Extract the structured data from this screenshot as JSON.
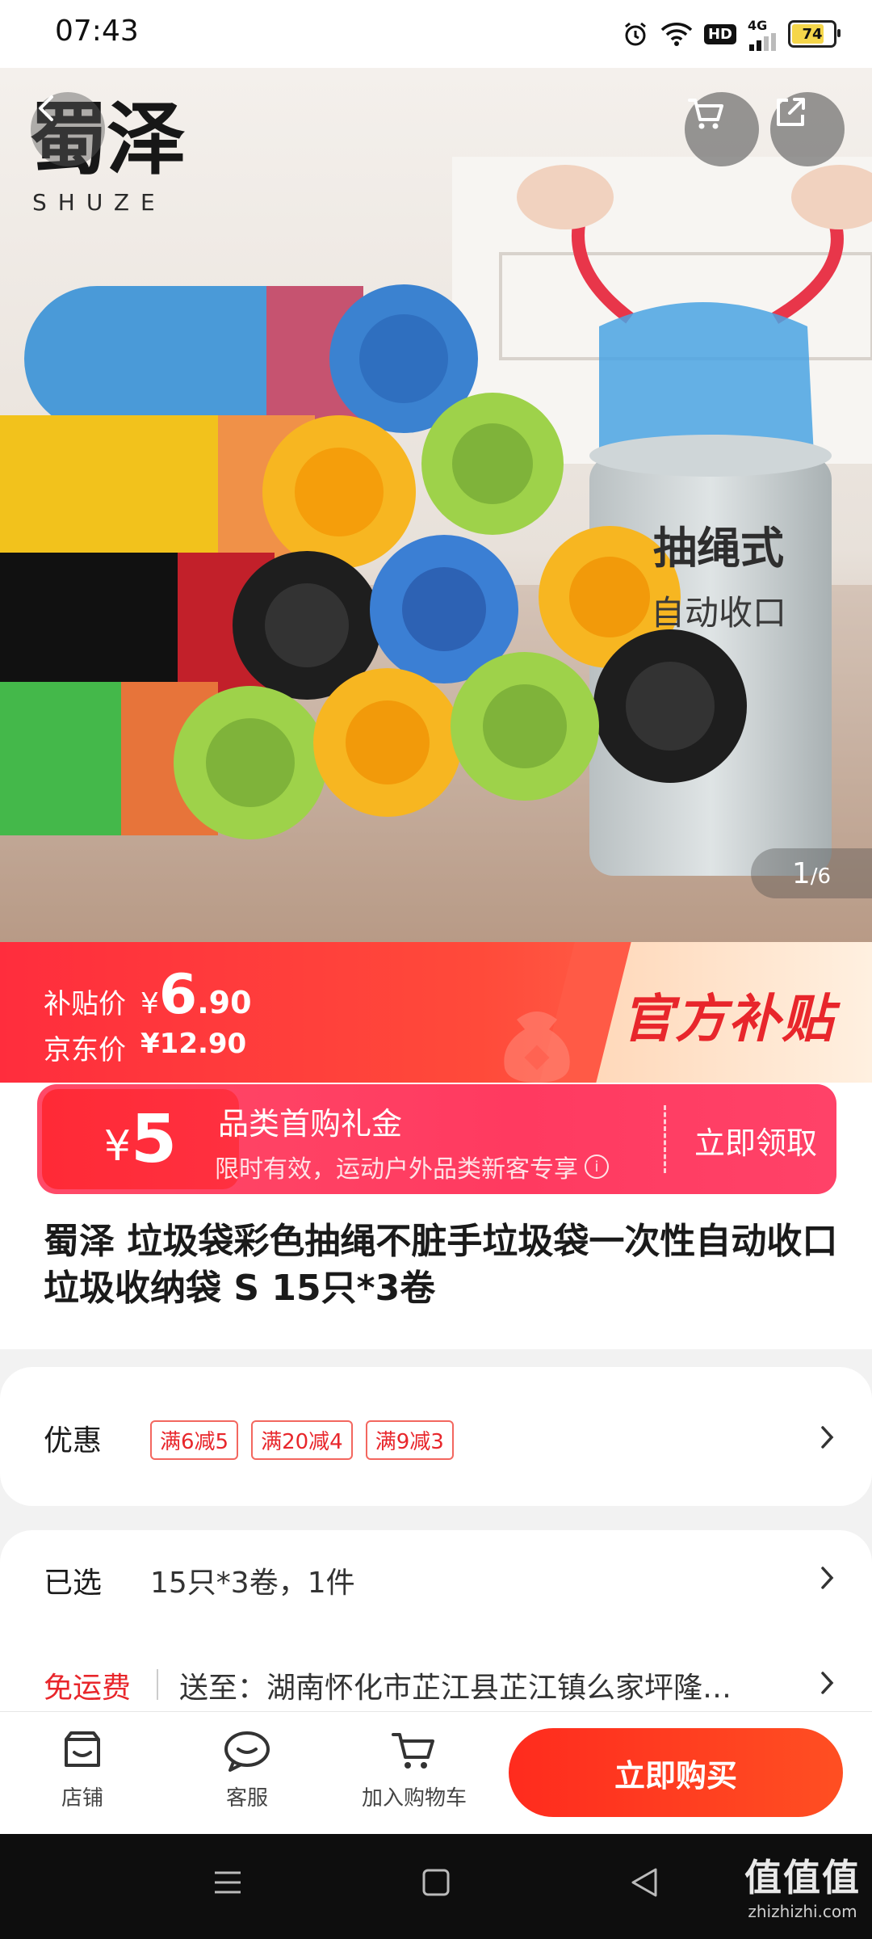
{
  "status_bar": {
    "time": "07:43",
    "hd_label": "HD",
    "network_label": "4G",
    "battery_level": "74",
    "icons": [
      "alarm-icon",
      "wifi-icon",
      "hd-icon",
      "cellular-signal-icon",
      "battery-icon"
    ]
  },
  "hero": {
    "brand_cn": "蜀泽",
    "brand_en": "SHUZE",
    "bag_caption_line1": "抽绳式",
    "bag_caption_line2": "自动收口",
    "pager_current": "1",
    "pager_total": "/6",
    "roll_colors": [
      "#4a9ad8",
      "#f2c21c",
      "#111111",
      "#44b84a",
      "#9ed24a",
      "#f7b621"
    ]
  },
  "price": {
    "subsidy_label": "补贴价",
    "subsidy_yen": "¥",
    "subsidy_int": "6",
    "subsidy_dec": ".90",
    "jd_label": "京东价",
    "jd_price": "¥12.90",
    "badge": "官方补贴"
  },
  "coupon": {
    "yen": "¥",
    "value": "5",
    "title": "品类首购礼金",
    "desc": "限时有效，运动户外品类新客专享",
    "claim": "立即领取"
  },
  "product": {
    "title": "蜀泽 垃圾袋彩色抽绳不脏手垃圾袋一次性自动收口垃圾收纳袋 S 15只*3卷"
  },
  "promo": {
    "label": "优惠",
    "tags": [
      "满6减5",
      "满20减4",
      "满9减3"
    ]
  },
  "selection": {
    "label": "已选",
    "value": "15只*3卷，1件"
  },
  "shipping": {
    "label": "免运费",
    "address": "送至：湖南怀化市芷江县芷江镇么家坪隆…"
  },
  "bottom_bar": {
    "store": "店铺",
    "service": "客服",
    "add_cart": "加入购物车",
    "buy_now": "立即购买"
  },
  "watermark": {
    "cn": "值值值",
    "en": "zhizhizhi.com"
  },
  "colors": {
    "accent_red": "#e8262b",
    "buy_button": "#ff3a1f",
    "coupon_pink": "#ff4468"
  }
}
